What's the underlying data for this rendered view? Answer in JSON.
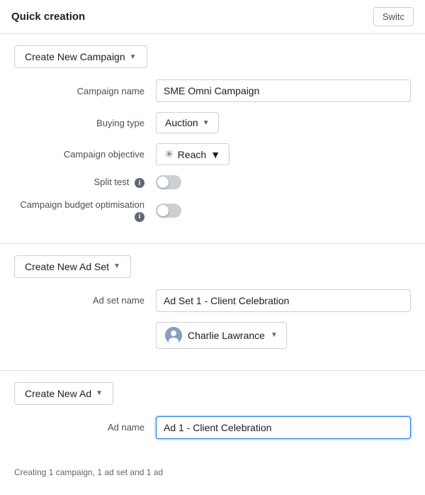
{
  "header": {
    "title": "Quick creation",
    "switch_label": "Switc"
  },
  "campaign_section": {
    "button_label": "Create New Campaign",
    "fields": {
      "campaign_name_label": "Campaign name",
      "campaign_name_value": "SME Omni Campaign",
      "buying_type_label": "Buying type",
      "buying_type_value": "Auction",
      "campaign_objective_label": "Campaign objective",
      "campaign_objective_value": "Reach",
      "split_test_label": "Split test",
      "campaign_budget_label": "Campaign budget optimisation"
    }
  },
  "adset_section": {
    "button_label": "Create New Ad Set",
    "fields": {
      "ad_set_name_label": "Ad set name",
      "ad_set_name_value": "Ad Set 1 - Client Celebration",
      "person_name": "Charlie Lawrance"
    }
  },
  "ad_section": {
    "button_label": "Create New Ad",
    "fields": {
      "ad_name_label": "Ad name",
      "ad_name_value": "Ad 1 - Client Celebration"
    }
  },
  "status_bar": {
    "text": "Creating 1 campaign, 1 ad set and 1 ad"
  },
  "icons": {
    "caret": "▼",
    "info": "i",
    "snowflake": "✳"
  }
}
